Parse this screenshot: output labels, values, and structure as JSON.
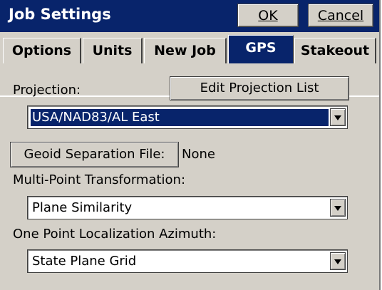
{
  "window": {
    "title": "Job Settings"
  },
  "title_buttons": {
    "ok": "OK",
    "cancel": "Cancel"
  },
  "tabs": [
    {
      "label": "Options",
      "active": false
    },
    {
      "label": "Units",
      "active": false
    },
    {
      "label": "New Job",
      "active": false
    },
    {
      "label": "GPS",
      "active": true
    },
    {
      "label": "Stakeout",
      "active": false
    }
  ],
  "projection": {
    "label": "Projection:",
    "edit_button": "Edit Projection List",
    "value": "USA/NAD83/AL East"
  },
  "geoid": {
    "button": "Geoid Separation File:",
    "value": "None"
  },
  "multi_point": {
    "label": "Multi-Point Transformation:",
    "value": "Plane Similarity"
  },
  "one_point": {
    "label": "One Point Localization Azimuth:",
    "value": "State Plane Grid"
  },
  "colors": {
    "title_bar": "#08246b",
    "face": "#d4d0c8",
    "selection": "#08246b"
  }
}
